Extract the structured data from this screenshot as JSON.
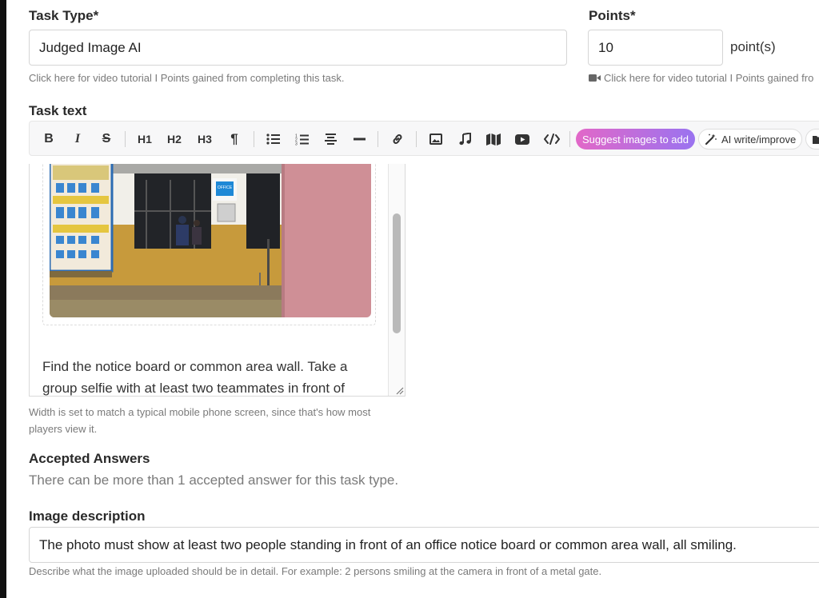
{
  "task_type": {
    "label": "Task Type*",
    "value": "Judged Image AI",
    "hint": "Click here for video tutorial I Points gained from completing this task."
  },
  "points": {
    "label": "Points*",
    "value": "10",
    "unit": "point(s)",
    "hint": "Click here for video tutorial I Points gained fro"
  },
  "task_text": {
    "label": "Task text",
    "toolbar": {
      "bold": "B",
      "italic": "I",
      "strike": "S",
      "h1": "H1",
      "h2": "H2",
      "h3": "H3",
      "paragraph": "¶",
      "suggest_images": "Suggest images to add",
      "ai_write": "AI write/improve"
    },
    "content_line1": "Find the notice board or common area wall. Take a",
    "content_line2": "group selfie with at least two teammates in front of",
    "width_hint_line1": "Width is set to match a typical mobile phone screen, since that's how most",
    "width_hint_line2": "players view it.",
    "photo_sign_text": "OFFICE"
  },
  "accepted_answers": {
    "label": "Accepted Answers",
    "text": "There can be more than 1 accepted answer for this task type."
  },
  "image_description": {
    "label": "Image description",
    "value": "The photo must show at least two people standing in front of an office notice board or common area wall, all smiling.",
    "hint": "Describe what the image uploaded should be in detail. For example: 2 persons smiling at the camera in front of a metal gate."
  },
  "colors": {
    "suggest_gradient_start": "#e268c8",
    "suggest_gradient_end": "#9a73f0",
    "wall_pink": "#cf8f96",
    "wall_ochre": "#c79a3c"
  }
}
